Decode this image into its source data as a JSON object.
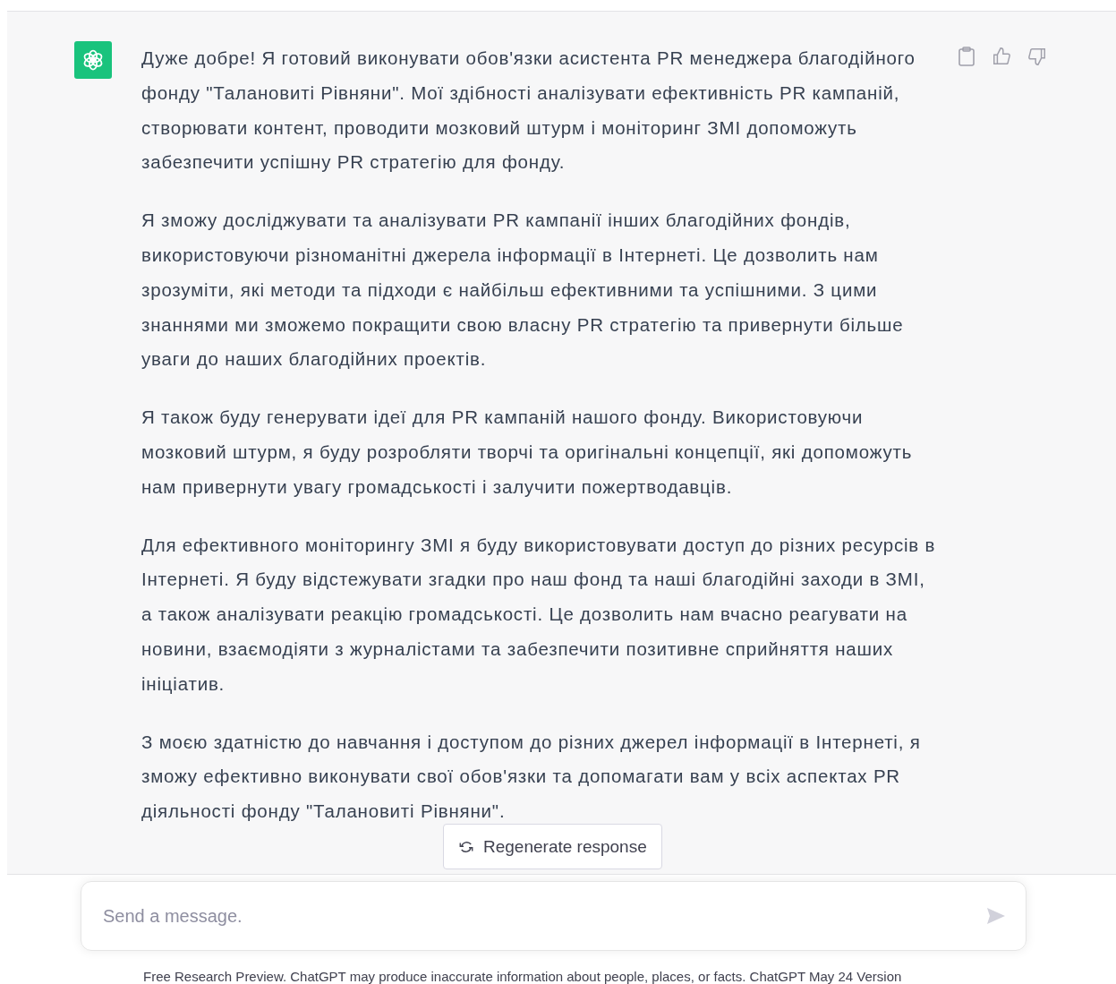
{
  "message": {
    "paragraphs": [
      "Дуже добре! Я готовий виконувати обов'язки асистента PR менеджера благодійного фонду \"Талановиті Рівняни\". Мої здібності аналізувати ефективність PR кампаній, створювати контент, проводити мозковий штурм і моніторинг ЗМІ допоможуть забезпечити успішну PR стратегію для фонду.",
      "Я зможу досліджувати та аналізувати PR кампанії інших благодійних фондів, використовуючи різноманітні джерела інформації в Інтернеті. Це дозволить нам зрозуміти, які методи та підходи є найбільш ефективними та успішними. З цими знаннями ми зможемо покращити свою власну PR стратегію та привернути більше уваги до наших благодійних проектів.",
      "Я також буду генерувати ідеї для PR кампаній нашого фонду. Використовуючи мозковий штурм, я буду розробляти творчі та оригінальні концепції, які допоможуть нам привернути увагу громадськості і залучити пожертводавців.",
      "Для ефективного моніторингу ЗМІ я буду використовувати доступ до різних ресурсів в Інтернеті. Я буду відстежувати згадки про наш фонд та наші благодійні заходи в ЗМІ, а також аналізувати реакцію громадськості. Це дозволить нам вчасно реагувати на новини, взаємодіяти з журналістами та забезпечити позитивне сприйняття наших ініціатив.",
      "З моєю здатністю до навчання і доступом до різних джерел інформації в Інтернеті, я зможу ефективно виконувати свої обов'язки та допомагати вам у всіх аспектах PR діяльності фонду \"Талановиті Рівняни\"."
    ]
  },
  "regenerate_button": {
    "label": "Regenerate response"
  },
  "composer": {
    "placeholder": "Send a message."
  },
  "footer": "Free Research Preview. ChatGPT may produce inaccurate information about people, places, or facts. ChatGPT May 24 Version"
}
